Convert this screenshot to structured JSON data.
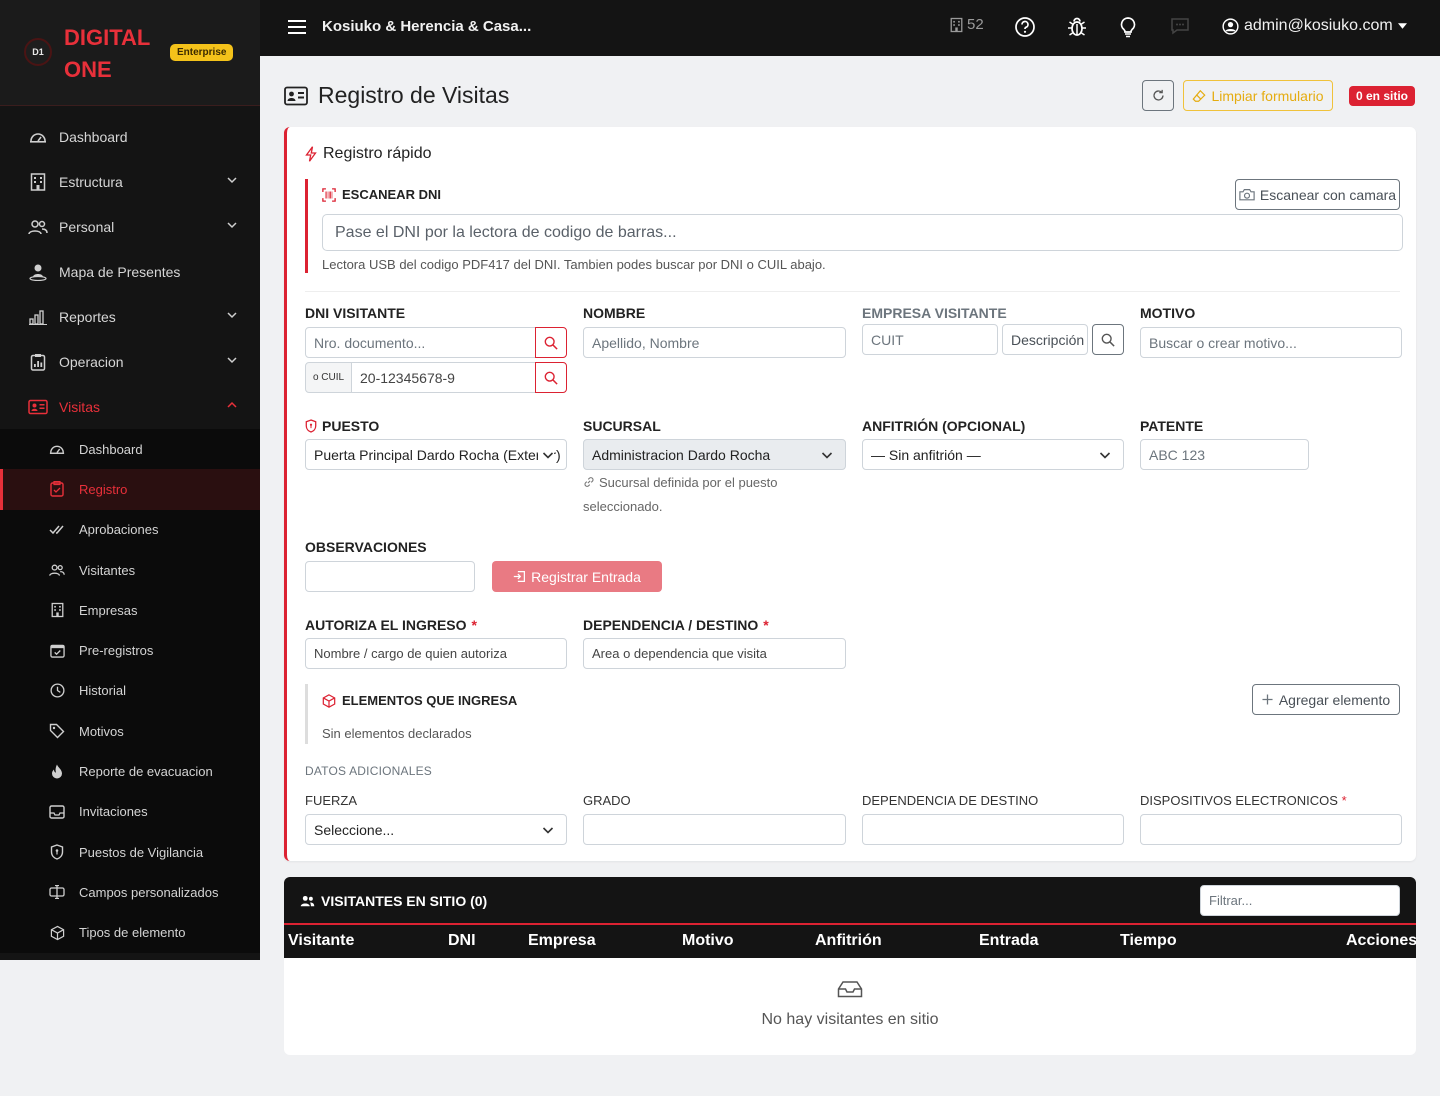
{
  "brand": {
    "logo_text": "D1",
    "name": "DIGITAL ONE",
    "badge": "Enterprise"
  },
  "sidebar": {
    "items": [
      {
        "label": "Dashboard",
        "icon": "gauge-icon"
      },
      {
        "label": "Estructura",
        "icon": "building-icon",
        "has_children": true
      },
      {
        "label": "Personal",
        "icon": "people-icon",
        "has_children": true
      },
      {
        "label": "Mapa de Presentes",
        "icon": "person-map-icon"
      },
      {
        "label": "Reportes",
        "icon": "bar-chart-icon",
        "has_children": true
      },
      {
        "label": "Operacion",
        "icon": "clipboard-data-icon",
        "has_children": true
      },
      {
        "label": "Visitas",
        "icon": "id-card-icon",
        "has_children": true,
        "open": true
      }
    ],
    "subitems": [
      {
        "label": "Dashboard",
        "icon": "gauge-icon"
      },
      {
        "label": "Registro",
        "icon": "clipboard-icon",
        "active": true
      },
      {
        "label": "Aprobaciones",
        "icon": "check-all-icon"
      },
      {
        "label": "Visitantes",
        "icon": "people-icon"
      },
      {
        "label": "Empresas",
        "icon": "building-icon"
      },
      {
        "label": "Pre-registros",
        "icon": "calendar-check-icon"
      },
      {
        "label": "Historial",
        "icon": "clock-icon"
      },
      {
        "label": "Motivos",
        "icon": "tags-icon"
      },
      {
        "label": "Reporte de evacuacion",
        "icon": "fire-icon"
      },
      {
        "label": "Invitaciones",
        "icon": "envelope-icon"
      },
      {
        "label": "Puestos de Vigilancia",
        "icon": "shield-icon"
      },
      {
        "label": "Campos personalizados",
        "icon": "input-cursor-icon"
      },
      {
        "label": "Tipos de elemento",
        "icon": "box-icon"
      }
    ]
  },
  "topbar": {
    "org_name": "Kosiuko & Herencia & Casa...",
    "building_count": "52",
    "user": "admin@kosiuko.com"
  },
  "page": {
    "title": "Registro de Visitas",
    "clear_label": "Limpiar formulario",
    "onsite_badge": "0 en sitio"
  },
  "quick": {
    "title": "Registro rápido",
    "scan_label": "ESCANEAR DNI",
    "scan_camera_label": "Escanear con camara",
    "scan_placeholder": "Pase el DNI por la lectora de codigo de barras...",
    "scan_help": "Lectora USB del codigo PDF417 del DNI. Tambien podes buscar por DNI o CUIL abajo."
  },
  "form": {
    "dni_label": "DNI VISITANTE",
    "dni_placeholder": "Nro. documento...",
    "cuil_prefix": "o CUIL",
    "cuil_placeholder": "20-12345678-9",
    "nombre_label": "NOMBRE",
    "nombre_placeholder": "Apellido, Nombre",
    "empresa_label": "EMPRESA VISITANTE",
    "empresa_cuit_placeholder": "CUIT",
    "empresa_desc_placeholder": "Descripción",
    "motivo_label": "MOTIVO",
    "motivo_placeholder": "Buscar o crear motivo...",
    "puesto_label": "PUESTO",
    "puesto_value": "Puerta Principal Dardo Rocha (Exterior)",
    "sucursal_label": "SUCURSAL",
    "sucursal_value": "Administracion Dardo Rocha",
    "sucursal_hint": "Sucursal definida por el puesto seleccionado.",
    "anfitrion_label": "ANFITRIÓN (OPCIONAL)",
    "anfitrion_value": "— Sin anfitrión —",
    "patente_label": "PATENTE",
    "patente_placeholder": "ABC 123",
    "observaciones_label": "OBSERVACIONES",
    "register_label": "Registrar Entrada",
    "autoriza_label": "AUTORIZA EL INGRESO",
    "autoriza_placeholder": "Nombre / cargo de quien autoriza",
    "dependencia_label": "DEPENDENCIA / DESTINO",
    "dependencia_placeholder": "Area o dependencia que visita",
    "required_mark": "*"
  },
  "elements": {
    "title": "ELEMENTOS QUE INGRESA",
    "empty": "Sin elementos declarados",
    "add_label": "Agregar elemento"
  },
  "extra": {
    "title": "DATOS ADICIONALES",
    "fuerza_label": "FUERZA",
    "fuerza_value": "Seleccione...",
    "grado_label": "GRADO",
    "dep_destino_label": "DEPENDENCIA DE DESTINO",
    "dispositivos_label": "DISPOSITIVOS ELECTRONICOS"
  },
  "visitors": {
    "title": "VISITANTES EN SITIO (0)",
    "filter_placeholder": "Filtrar...",
    "columns": [
      "Visitante",
      "DNI",
      "Empresa",
      "Motivo",
      "Anfitrión",
      "Entrada",
      "Tiempo",
      "Acciones"
    ],
    "empty": "No hay visitantes en sitio"
  },
  "colors": {
    "accent": "#dc2232",
    "sidebar_bg": "#141414",
    "warning": "#f0c23a"
  }
}
